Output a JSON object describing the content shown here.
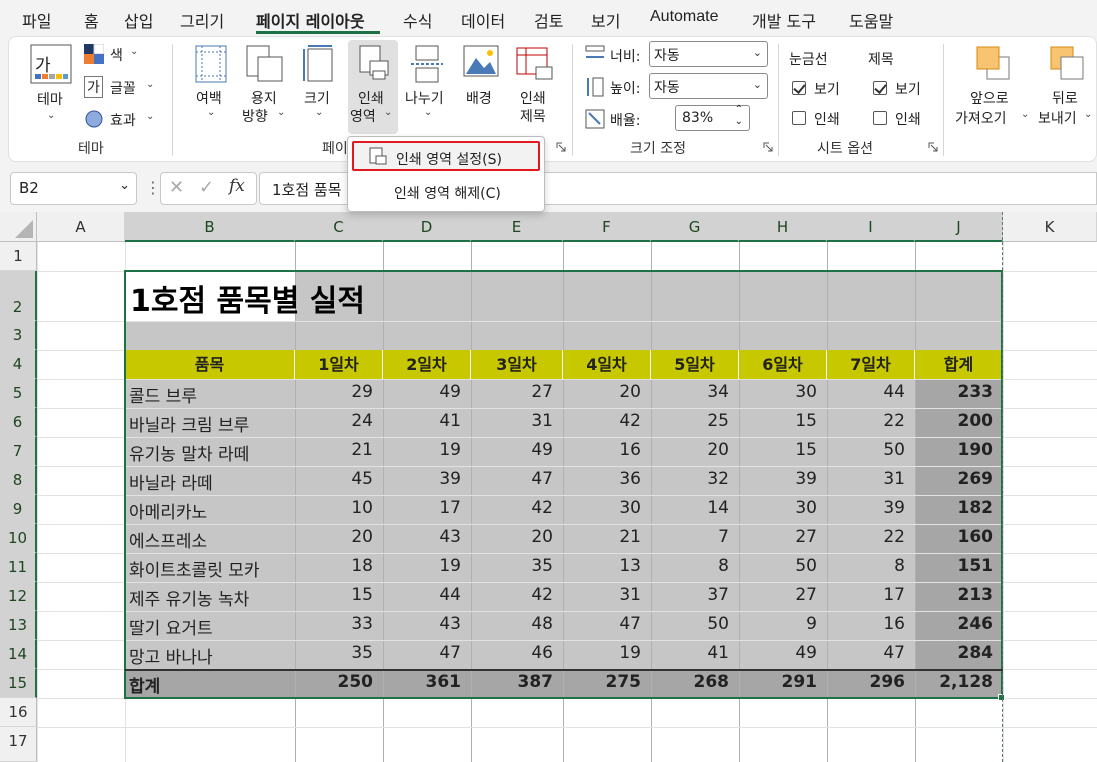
{
  "tabs": [
    "파일",
    "홈",
    "삽입",
    "그리기",
    "페이지 레이아웃",
    "수식",
    "데이터",
    "검토",
    "보기",
    "Automate",
    "개발 도구",
    "도움말"
  ],
  "active_tab": "페이지 레이아웃",
  "ribbon": {
    "theme": {
      "label": "테마",
      "theme_icon_text": "가",
      "colors": "색",
      "fonts": "글꼴",
      "fonts_icon_text": "가",
      "effects": "효과",
      "group": "테마"
    },
    "page_setup": {
      "margins": "여백",
      "orientation_1": "용지",
      "orientation_2": "방향",
      "size": "크기",
      "print_area_1": "인쇄",
      "print_area_2": "영역",
      "breaks": "나누기",
      "background": "배경",
      "print_titles_1": "인쇄",
      "print_titles_2": "제목",
      "group": "페이"
    },
    "scale_to_fit": {
      "width_label": "너비:",
      "width_value": "자동",
      "height_label": "높이:",
      "height_value": "자동",
      "scale_label": "배율:",
      "scale_value": "83%",
      "group": "크기 조정"
    },
    "sheet_options": {
      "gridlines": "눈금선",
      "headings": "제목",
      "view": "보기",
      "print": "인쇄",
      "gridlines_view": true,
      "gridlines_print": false,
      "headings_view": true,
      "headings_print": false,
      "group": "시트 옵션"
    },
    "arrange": {
      "bring_forward_1": "앞으로",
      "bring_forward_2": "가져오기",
      "send_backward_1": "뒤로",
      "send_backward_2": "보내기"
    }
  },
  "print_area_menu": {
    "set": "인쇄 영역 설정(S)",
    "clear": "인쇄 영역 해제(C)"
  },
  "formula_bar": {
    "name_box": "B2",
    "formula": "1호점 품목별 실적",
    "formula_visible": "1호점 품목"
  },
  "columns": [
    "A",
    "B",
    "C",
    "D",
    "E",
    "F",
    "G",
    "H",
    "I",
    "J",
    "K"
  ],
  "rows": [
    "1",
    "2",
    "3",
    "4",
    "5",
    "6",
    "7",
    "8",
    "9",
    "10",
    "11",
    "12",
    "13",
    "14",
    "15",
    "16",
    "17"
  ],
  "sheet": {
    "title": "1호점 품목별 실적",
    "headers": [
      "품목",
      "1일차",
      "2일차",
      "3일차",
      "4일차",
      "5일차",
      "6일차",
      "7일차",
      "합계"
    ],
    "items": [
      {
        "name": "콜드 브루",
        "values": [
          "29",
          "49",
          "27",
          "20",
          "34",
          "30",
          "44"
        ],
        "total": "233"
      },
      {
        "name": "바닐라 크림 브루",
        "values": [
          "24",
          "41",
          "31",
          "42",
          "25",
          "15",
          "22"
        ],
        "total": "200"
      },
      {
        "name": "유기농 말차 라떼",
        "values": [
          "21",
          "19",
          "49",
          "16",
          "20",
          "15",
          "50"
        ],
        "total": "190"
      },
      {
        "name": "바닐라 라떼",
        "values": [
          "45",
          "39",
          "47",
          "36",
          "32",
          "39",
          "31"
        ],
        "total": "269"
      },
      {
        "name": "아메리카노",
        "values": [
          "10",
          "17",
          "42",
          "30",
          "14",
          "30",
          "39"
        ],
        "total": "182"
      },
      {
        "name": "에스프레소",
        "values": [
          "20",
          "43",
          "20",
          "21",
          "7",
          "27",
          "22"
        ],
        "total": "160"
      },
      {
        "name": "화이트초콜릿 모카",
        "values": [
          "18",
          "19",
          "35",
          "13",
          "8",
          "50",
          "8"
        ],
        "total": "151"
      },
      {
        "name": "제주 유기농 녹차",
        "values": [
          "15",
          "44",
          "42",
          "31",
          "37",
          "27",
          "17"
        ],
        "total": "213"
      },
      {
        "name": "딸기 요거트",
        "values": [
          "33",
          "43",
          "48",
          "47",
          "50",
          "9",
          "16"
        ],
        "total": "246"
      },
      {
        "name": "망고 바나나",
        "values": [
          "35",
          "47",
          "46",
          "19",
          "41",
          "49",
          "47"
        ],
        "total": "284"
      }
    ],
    "totals_label": "합계",
    "totals": [
      "250",
      "361",
      "387",
      "275",
      "268",
      "291",
      "296",
      "2,128"
    ]
  },
  "colors": {
    "header_fill": "#c8c800",
    "selection_fill": "#c6c6c6",
    "total_col_fill": "#a6a6a6",
    "accent_green": "#1e7145",
    "highlight_red": "#e0191c"
  }
}
